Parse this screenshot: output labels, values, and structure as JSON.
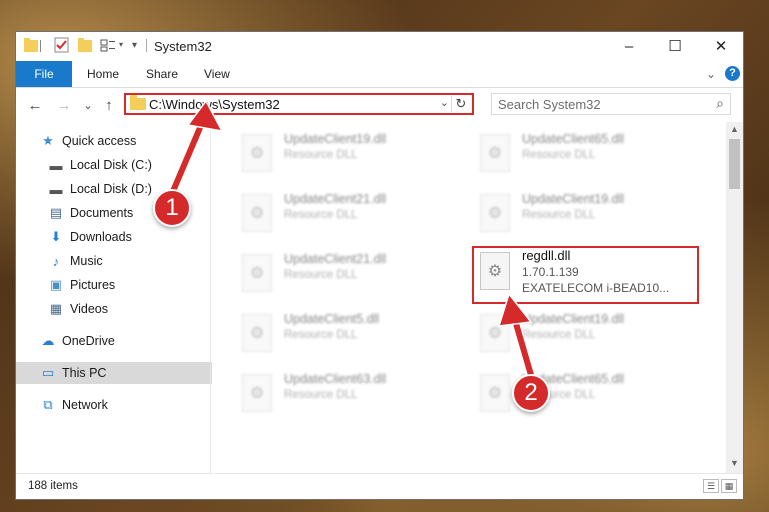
{
  "window": {
    "title": "System32",
    "controls": {
      "minimize": "–",
      "maximize": "☐",
      "close": "✕"
    }
  },
  "ribbon": {
    "tabs": [
      "File",
      "Home",
      "Share",
      "View"
    ],
    "expand_icon": "⌄",
    "help_icon": "?"
  },
  "nav": {
    "back": "←",
    "forward": "→",
    "recent": "⌄",
    "up": "↑",
    "address": "C:\\Windows\\System32",
    "address_dropdown": "⌄",
    "refresh": "↻",
    "search_placeholder": "Search System32",
    "search_icon": "⌕"
  },
  "sidebar": {
    "items": [
      {
        "label": "Quick access",
        "icon": "star-icon",
        "glyph": "★",
        "color": "#3b8fd6"
      },
      {
        "label": "Local Disk (C:)",
        "icon": "drive-icon",
        "glyph": "▬",
        "color": "#555555",
        "pinned": true
      },
      {
        "label": "Local Disk (D:)",
        "icon": "drive-icon",
        "glyph": "▬",
        "color": "#555555",
        "pinned": true
      },
      {
        "label": "Documents",
        "icon": "documents-icon",
        "glyph": "▤",
        "color": "#4a6b8a",
        "pinned": true
      },
      {
        "label": "Downloads",
        "icon": "download-icon",
        "glyph": "⬇",
        "color": "#2b7fd1",
        "pinned": true
      },
      {
        "label": "Music",
        "icon": "music-icon",
        "glyph": "♪",
        "color": "#2b7fd1",
        "pinned": true
      },
      {
        "label": "Pictures",
        "icon": "pictures-icon",
        "glyph": "▣",
        "color": "#4a90c8",
        "pinned": true
      },
      {
        "label": "Videos",
        "icon": "videos-icon",
        "glyph": "▦",
        "color": "#4a6b8a",
        "pinned": true
      },
      {
        "label": "OneDrive",
        "icon": "cloud-icon",
        "glyph": "☁",
        "color": "#2b7fd1"
      },
      {
        "label": "This PC",
        "icon": "computer-icon",
        "glyph": "▭",
        "color": "#2b7fd1"
      },
      {
        "label": "Network",
        "icon": "network-icon",
        "glyph": "⧉",
        "color": "#2b7fd1"
      }
    ],
    "pin_glyph": "📌"
  },
  "files": {
    "left_column": [
      {
        "name": "UpdateClient19.dll",
        "desc": "Resource DLL"
      },
      {
        "name": "UpdateClient21.dll",
        "desc": "Resource DLL"
      },
      {
        "name": "UpdateClient21.dll",
        "desc": "Resource DLL"
      },
      {
        "name": "UpdateClient5.dll",
        "desc": "Resource DLL"
      },
      {
        "name": "UpdateClient63.dll",
        "desc": "Resource DLL"
      }
    ],
    "right_column": [
      {
        "name": "UpdateClient65.dll",
        "desc": "Resource DLL"
      },
      {
        "name": "UpdateClient19.dll",
        "desc": "Resource DLL"
      },
      {
        "name": "UpdateClient19.dll",
        "desc": "Resource DLL"
      },
      {
        "name": "UpdateClient65.dll",
        "desc": "Resource DLL"
      }
    ],
    "highlighted": {
      "name": "regdll.dll",
      "version": "1.70.1.139",
      "company": "EXATELECOM i-BEAD10..."
    },
    "file_glyph": "⚙"
  },
  "status": {
    "count": "188 items"
  },
  "annotations": {
    "step1": "1",
    "step2": "2",
    "color": "#d52a2a"
  }
}
